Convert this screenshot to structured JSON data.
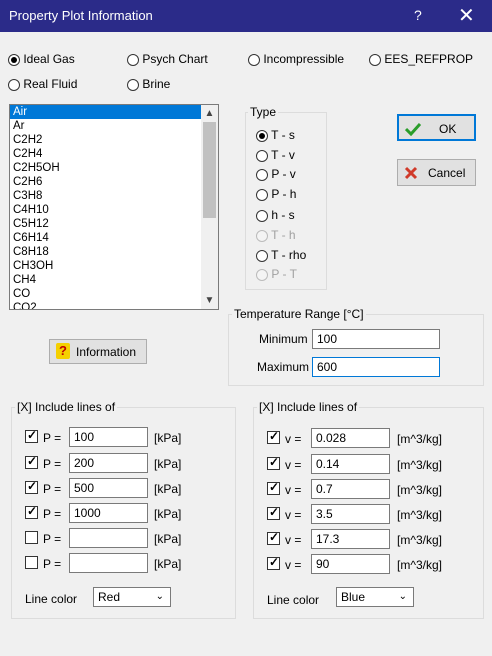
{
  "window": {
    "title": "Property Plot Information",
    "help": "?",
    "close": "✕"
  },
  "fluid_types": [
    {
      "label": "Ideal Gas",
      "selected": true
    },
    {
      "label": "Psych Chart",
      "selected": false
    },
    {
      "label": "Incompressible",
      "selected": false
    },
    {
      "label": "EES_REFPROP",
      "selected": false
    },
    {
      "label": "Real Fluid",
      "selected": false
    },
    {
      "label": "Brine",
      "selected": false
    }
  ],
  "fluid_list": {
    "items": [
      "Air",
      "Ar",
      "C2H2",
      "C2H4",
      "C2H5OH",
      "C2H6",
      "C3H8",
      "C4H10",
      "C5H12",
      "C6H14",
      "C8H18",
      "CH3OH",
      "CH4",
      "CO",
      "CO2"
    ],
    "selected": "Air",
    "scroll_up": "▲",
    "scroll_down": "▼"
  },
  "type_group": {
    "label": "Type",
    "options": [
      {
        "label": "T - s",
        "selected": true,
        "enabled": true
      },
      {
        "label": "T - v",
        "selected": false,
        "enabled": true
      },
      {
        "label": "P - v",
        "selected": false,
        "enabled": true
      },
      {
        "label": "P - h",
        "selected": false,
        "enabled": true
      },
      {
        "label": "h - s",
        "selected": false,
        "enabled": true
      },
      {
        "label": "T - h",
        "selected": false,
        "enabled": false
      },
      {
        "label": "T - rho",
        "selected": false,
        "enabled": true
      },
      {
        "label": "P - T",
        "selected": false,
        "enabled": false
      }
    ]
  },
  "buttons": {
    "ok": "OK",
    "cancel": "Cancel",
    "information": "Information"
  },
  "temperature_range": {
    "label": "Temperature Range [°C]",
    "min_label": "Minimum",
    "min_value": "100",
    "max_label": "Maximum",
    "max_value": "600"
  },
  "pressure_lines": {
    "label": "[X] Include lines of",
    "var_label": "P =",
    "unit": "[kPa]",
    "rows": [
      {
        "checked": true,
        "value": "100"
      },
      {
        "checked": true,
        "value": "200"
      },
      {
        "checked": true,
        "value": "500"
      },
      {
        "checked": true,
        "value": "1000"
      },
      {
        "checked": false,
        "value": ""
      },
      {
        "checked": false,
        "value": ""
      }
    ],
    "line_color_label": "Line color",
    "line_color": "Red"
  },
  "volume_lines": {
    "label": "[X] Include lines of",
    "var_label": "v =",
    "unit": "[m^3/kg]",
    "rows": [
      {
        "checked": true,
        "value": "0.028"
      },
      {
        "checked": true,
        "value": "0.14"
      },
      {
        "checked": true,
        "value": "0.7"
      },
      {
        "checked": true,
        "value": "3.5"
      },
      {
        "checked": true,
        "value": "17.3"
      },
      {
        "checked": true,
        "value": "90"
      }
    ],
    "line_color_label": "Line color",
    "line_color": "Blue"
  },
  "colors": {
    "titlebar": "#2b2b89",
    "selection": "#0078d7",
    "ok_check": "#2a9d2a",
    "cancel_x": "#d03a2a"
  }
}
